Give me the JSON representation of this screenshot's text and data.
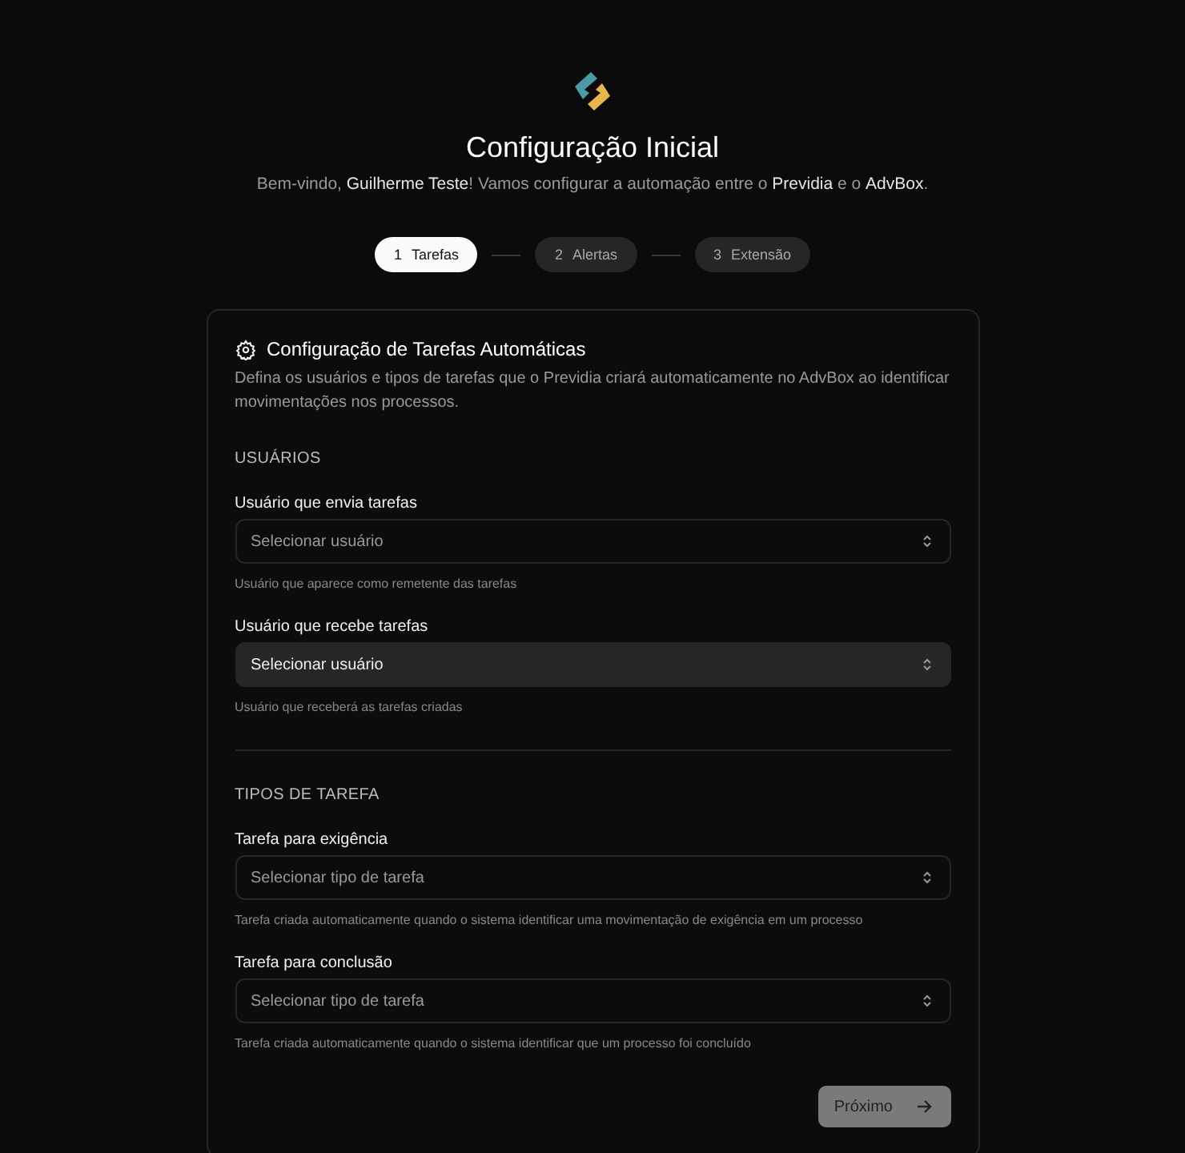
{
  "header": {
    "title": "Configuração Inicial",
    "subtitle": "Bem-vindo, **Guilherme Teste**! Vamos configurar a automação entre o **Previdia** e o **AdvBox**."
  },
  "steps": [
    {
      "number": "1",
      "label": "Tarefas",
      "selected": true
    },
    {
      "number": "2",
      "label": "Alertas",
      "selected": false
    },
    {
      "number": "3",
      "label": "Extensão",
      "selected": false
    }
  ],
  "card": {
    "title": "Configuração de Tarefas Automáticas",
    "description": "Defina os usuários e tipos de tarefas que o Previdia criará automaticamente no AdvBox ao identificar movimentações nos processos.",
    "sections": [
      {
        "heading": "USUÁRIOS",
        "fields": [
          {
            "label": "Usuário que envia tarefas",
            "placeholder": "Selecionar usuário",
            "help": "Usuário que aparece como remetente das tarefas",
            "focused": false
          },
          {
            "label": "Usuário que recebe tarefas",
            "placeholder": "Selecionar usuário",
            "help": "Usuário que receberá as tarefas criadas",
            "focused": true
          }
        ]
      },
      {
        "heading": "TIPOS DE TAREFA",
        "fields": [
          {
            "label": "Tarefa para exigência",
            "placeholder": "Selecionar tipo de tarefa",
            "help": "Tarefa criada automaticamente quando o sistema identificar uma movimentação de exigência em um processo",
            "focused": false
          },
          {
            "label": "Tarefa para conclusão",
            "placeholder": "Selecionar tipo de tarefa",
            "help": "Tarefa criada automaticamente quando o sistema identificar que um processo foi concluído",
            "focused": false
          }
        ]
      }
    ],
    "next_button": {
      "label": "Próximo",
      "disabled": true
    }
  }
}
